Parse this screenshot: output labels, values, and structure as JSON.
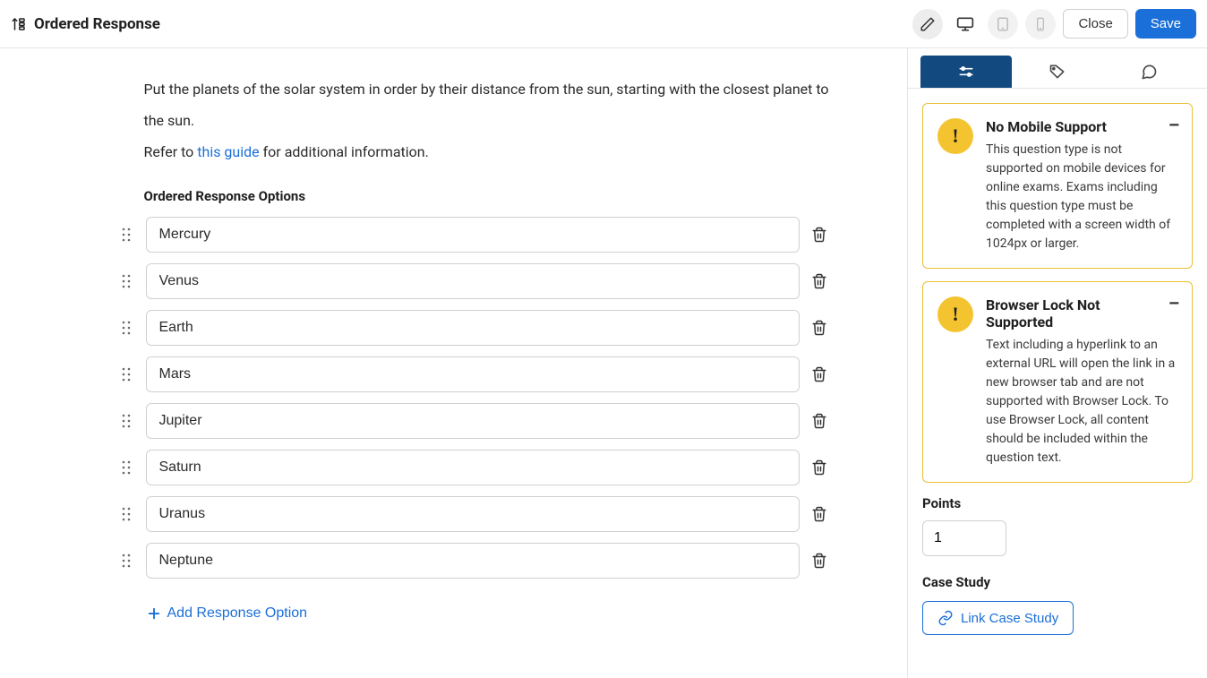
{
  "header": {
    "title": "Ordered Response",
    "close_label": "Close",
    "save_label": "Save"
  },
  "question": {
    "text_parts": {
      "p1": "Put the planets of the solar system in order by their distance from the sun, starting with the closest planet to the sun.",
      "p2_pre": "Refer to ",
      "p2_link": "this guide",
      "p2_post": " for additional information."
    },
    "options_label": "Ordered Response Options",
    "options": [
      {
        "value": "Mercury"
      },
      {
        "value": "Venus"
      },
      {
        "value": "Earth"
      },
      {
        "value": "Mars"
      },
      {
        "value": "Jupiter"
      },
      {
        "value": "Saturn"
      },
      {
        "value": "Uranus"
      },
      {
        "value": "Neptune"
      }
    ],
    "add_option_label": "Add Response Option"
  },
  "sidebar": {
    "warnings": [
      {
        "icon": "!",
        "title": "No Mobile Support",
        "text": "This question type is not supported on mobile devices for online exams. Exams including this question type must be completed with a screen width of 1024px or larger."
      },
      {
        "icon": "!",
        "title": "Browser Lock Not Supported",
        "text": "Text including a hyperlink to an external URL will open the link in a new browser tab and are not supported with Browser Lock. To use Browser Lock, all content should be included within the question text."
      }
    ],
    "points": {
      "label": "Points",
      "value": "1"
    },
    "case_study": {
      "label": "Case Study",
      "link_label": "Link Case Study"
    }
  }
}
